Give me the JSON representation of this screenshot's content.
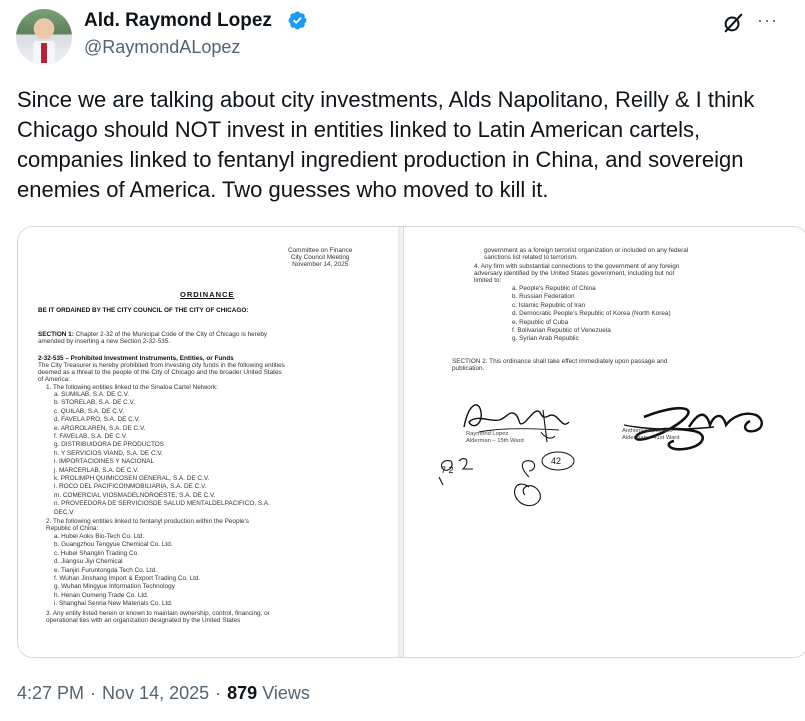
{
  "author": {
    "name": "Ald. Raymond Lopez",
    "handle": "@RaymondALopez",
    "verified": true,
    "badge_color": "#1d9bf0"
  },
  "header_icons": {
    "grok_icon": "grok-slash-icon",
    "more_icon": "more-dots-icon",
    "more_glyph": "···"
  },
  "tweet": {
    "text": "Since we are talking about city investments, Alds Napolitano, Reilly & I think Chicago should NOT invest in entities linked to Latin American cartels, companies linked to fentanyl ingredient production in China, and sovereign enemies of America. Two guesses who moved to kill it."
  },
  "document": {
    "left_page": {
      "header": [
        "Committee on Finance",
        "City Council Meeting",
        "November 14, 2025"
      ],
      "title": "ORDINANCE",
      "ordained": "BE IT ORDAINED BY THE CITY COUNCIL OF THE CITY OF CHICAGO:",
      "section1_label": "SECTION 1:",
      "section1_text": " Chapter 2-32 of the Municipal Code of the City of Chicago is hereby",
      "section1_text2": "amended by inserting a new Section 2-32-535.",
      "subsection_title": "2-32-535 – Prohibited Investment Instruments, Entities, or Funds",
      "intro": [
        "The City Treasurer is hereby prohibited from investing city funds in the following entities",
        "deemed as a threat to the people of the City of Chicago and the broader United States",
        "of America:"
      ],
      "item1": "1.  The following entities linked to the Sinaloa Cartel Network:",
      "cartel_entities": [
        "a.  SUMILAB, S.A. DE C.V.",
        "b.  STORELAB, S.A. DE C.V.",
        "c.  QUILAB, S.A. DE C.V.",
        "d.  FAVELA PRO, S.A. DE C.V.",
        "e.  ARGROLAREN, S.A. DE C.V.",
        "f.  FAVELAB, S.A. DE C.V.",
        "g.  DISTRIBUIDORA DE PRODUCTOS",
        "h.  Y SERVICIOS VIAND, S.A. DE C.V.",
        "i.  IMPORTACIOINES Y NACIONAL",
        "j.  MARCERLAB, S.A. DE C.V.",
        "k.  PROLIMPH QUIMICOSEN GENERAL, S.A. DE C.V.",
        "l.  ROCO DEL PACIFICOINMOBILIARIA, S.A. DE C.V.",
        "m.  COMERCIAL VIOSMADELNOROESTE, S.A. DE C.V.",
        "n.  PROVEEDORA DE SERVICIOSDE SALUD MENTALDELPACIFICO, S.A.",
        "      DEC.V"
      ],
      "item2": [
        "2.  The following entities linked to fentanyl production within the People's",
        "      Republic of China:"
      ],
      "china_entities": [
        "a.  Hubei Aoks Bio-Tech Co. Ltd.",
        "b.  Guangzhou Tengyue Chemical Co. Ltd.",
        "c.  Hubei Shanglin Trading Co.",
        "d.  Jiangsu Jiyi Chemical",
        "e.  Tianjin Furuntongda Tech Co. Ltd.",
        "f.   Wuhan Jinshang Import & Export Trading Co. Ltd.",
        "g.  Wuhan Mingyue Information Technology",
        "h.  Henan Oumeng Trade Co. Ltd.",
        "i.   Shanghai Senria New Materials Co. Ltd."
      ],
      "item3": [
        "3.  Any entity listed herein or known to maintain ownership, control, financing, or",
        "      operational ties with an organization designated by the United States"
      ]
    },
    "right_page": {
      "continuation": [
        "government as a foreign terrorist organization or included on any federal",
        "sanctions list related to terrorism."
      ],
      "item4": [
        "4.  Any firm with substantial connections to the government of any foreign",
        "      adversary identified by the United States government, including but not",
        "      limited to:"
      ],
      "adversaries": [
        "a.  People's Republic of China",
        "b.  Russian Federation",
        "c.  Islamic Republic of Iran",
        "d.  Democratic People's Republic of Korea (North Korea)",
        "e.  Republic of Cuba",
        "f.   Bolivarian Republic of Venezuela",
        "g.  Syrian Arab Republic"
      ],
      "section2": [
        "SECTION 2: This ordinance shall take effect immediately upon passage and",
        "publication."
      ],
      "signer1": [
        "Raymond Lopez",
        "Alderman – 15th Ward"
      ],
      "signer2": [
        "Anthony Napolitano",
        "Alderman – 41st Ward"
      ],
      "handwritten": [
        "7 2",
        "42"
      ]
    }
  },
  "meta": {
    "time": "4:27 PM",
    "date": "Nov 14, 2025",
    "views_count": "879",
    "views_label": "Views",
    "separator": "·"
  }
}
